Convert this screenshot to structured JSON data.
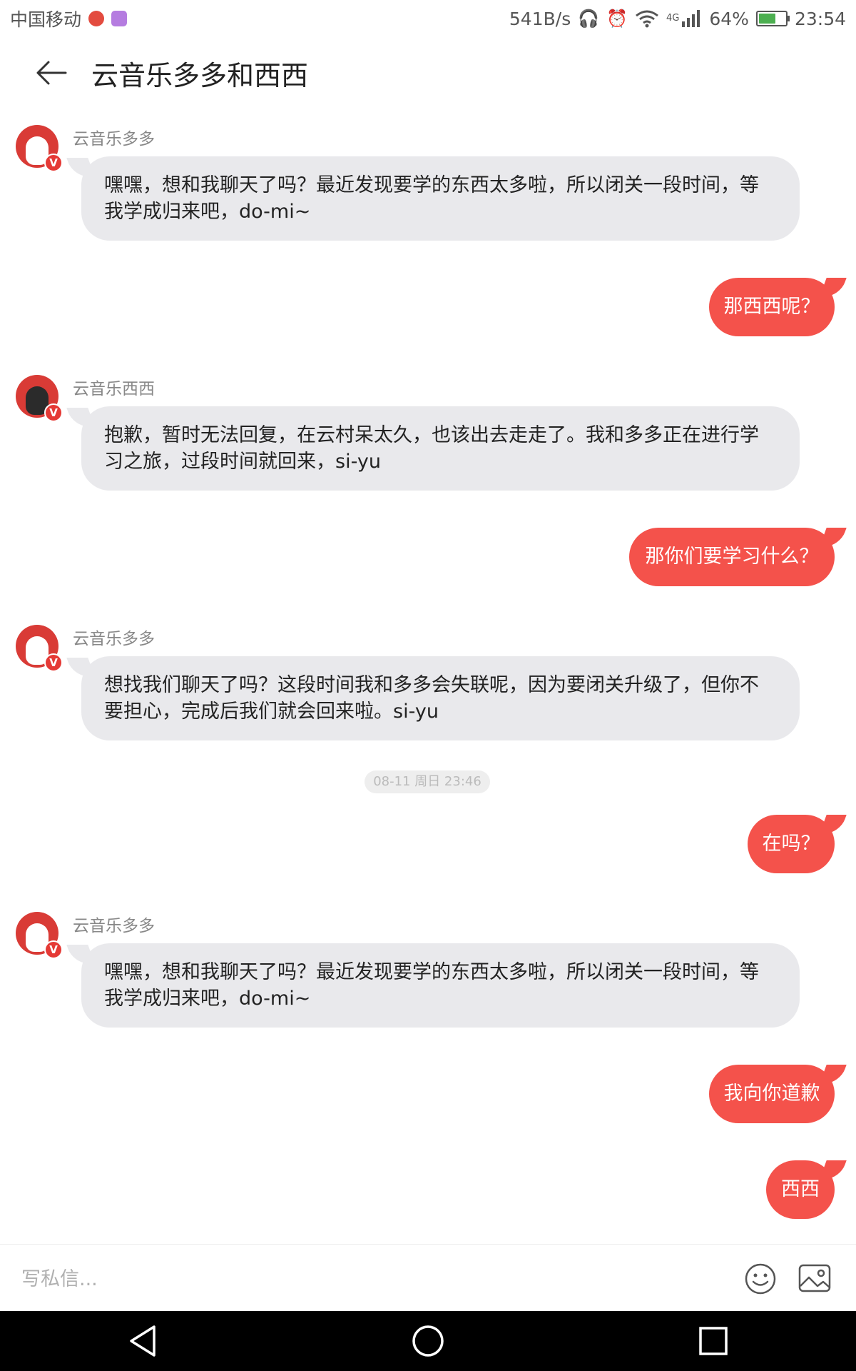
{
  "status_bar": {
    "carrier": "中国移动",
    "net_speed": "541B/s",
    "network_type": "4G",
    "battery": "64%",
    "battery_level": 0.64,
    "time": "23:54"
  },
  "header": {
    "title": "云音乐多多和西西"
  },
  "messages": [
    {
      "type": "incoming",
      "sender": "云音乐多多",
      "text": "嘿嘿，想和我聊天了吗？最近发现要学的东西太多啦，所以闭关一段时间，等我学成归来吧，do-mi~"
    },
    {
      "type": "outgoing",
      "text": "那西西呢？"
    },
    {
      "type": "incoming",
      "sender": "云音乐西西",
      "text": "抱歉，暂时无法回复，在云村呆太久，也该出去走走了。我和多多正在进行学习之旅，过段时间就回来，si-yu"
    },
    {
      "type": "outgoing",
      "text": "那你们要学习什么？"
    },
    {
      "type": "incoming",
      "sender": "云音乐多多",
      "text": "想找我们聊天了吗？这段时间我和多多会失联呢，因为要闭关升级了，但你不要担心，完成后我们就会回来啦。si-yu"
    },
    {
      "type": "timestamp",
      "text": "08-11 周日 23:46"
    },
    {
      "type": "outgoing",
      "text": "在吗？"
    },
    {
      "type": "incoming",
      "sender": "云音乐多多",
      "text": "嘿嘿，想和我聊天了吗？最近发现要学的东西太多啦，所以闭关一段时间，等我学成归来吧，do-mi~"
    },
    {
      "type": "outgoing",
      "text": "我向你道歉"
    },
    {
      "type": "outgoing",
      "text": "西西"
    }
  ],
  "avatar_badge": "V",
  "input": {
    "placeholder": "写私信..."
  },
  "colors": {
    "accent": "#f4524b",
    "incoming_bubble": "#e9e9ec"
  },
  "icons": [
    "back-arrow-icon",
    "emoji-icon",
    "image-icon",
    "nav-back-icon",
    "nav-home-icon",
    "nav-recents-icon"
  ]
}
